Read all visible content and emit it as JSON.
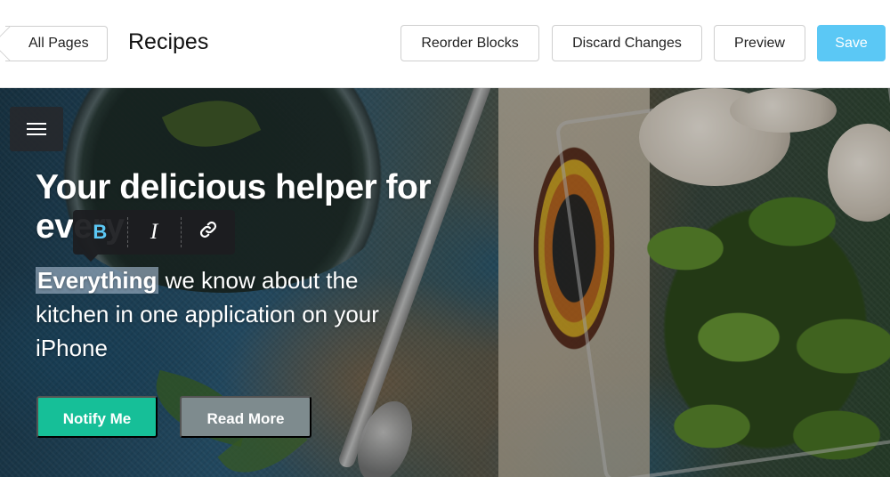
{
  "toolbar": {
    "back_label": "All Pages",
    "page_title": "Recipes",
    "reorder_label": "Reorder Blocks",
    "discard_label": "Discard Changes",
    "preview_label": "Preview",
    "save_label": "Save",
    "save_color": "#5bc8f5"
  },
  "hero": {
    "menu_icon": "hamburger-icon",
    "headline": "Your delicious helper for every",
    "subcopy_selected": "Everything",
    "subcopy_rest": " we know about the kitchen in one application on your iPhone",
    "notify_label": "Notify Me",
    "notify_color": "#16bf98",
    "readmore_label": "Read More",
    "readmore_color": "#7e8b8e"
  },
  "format_toolbar": {
    "bold_label": "B",
    "italic_label": "I",
    "link_icon": "link-icon",
    "bold_active_color": "#5bc8f5"
  }
}
